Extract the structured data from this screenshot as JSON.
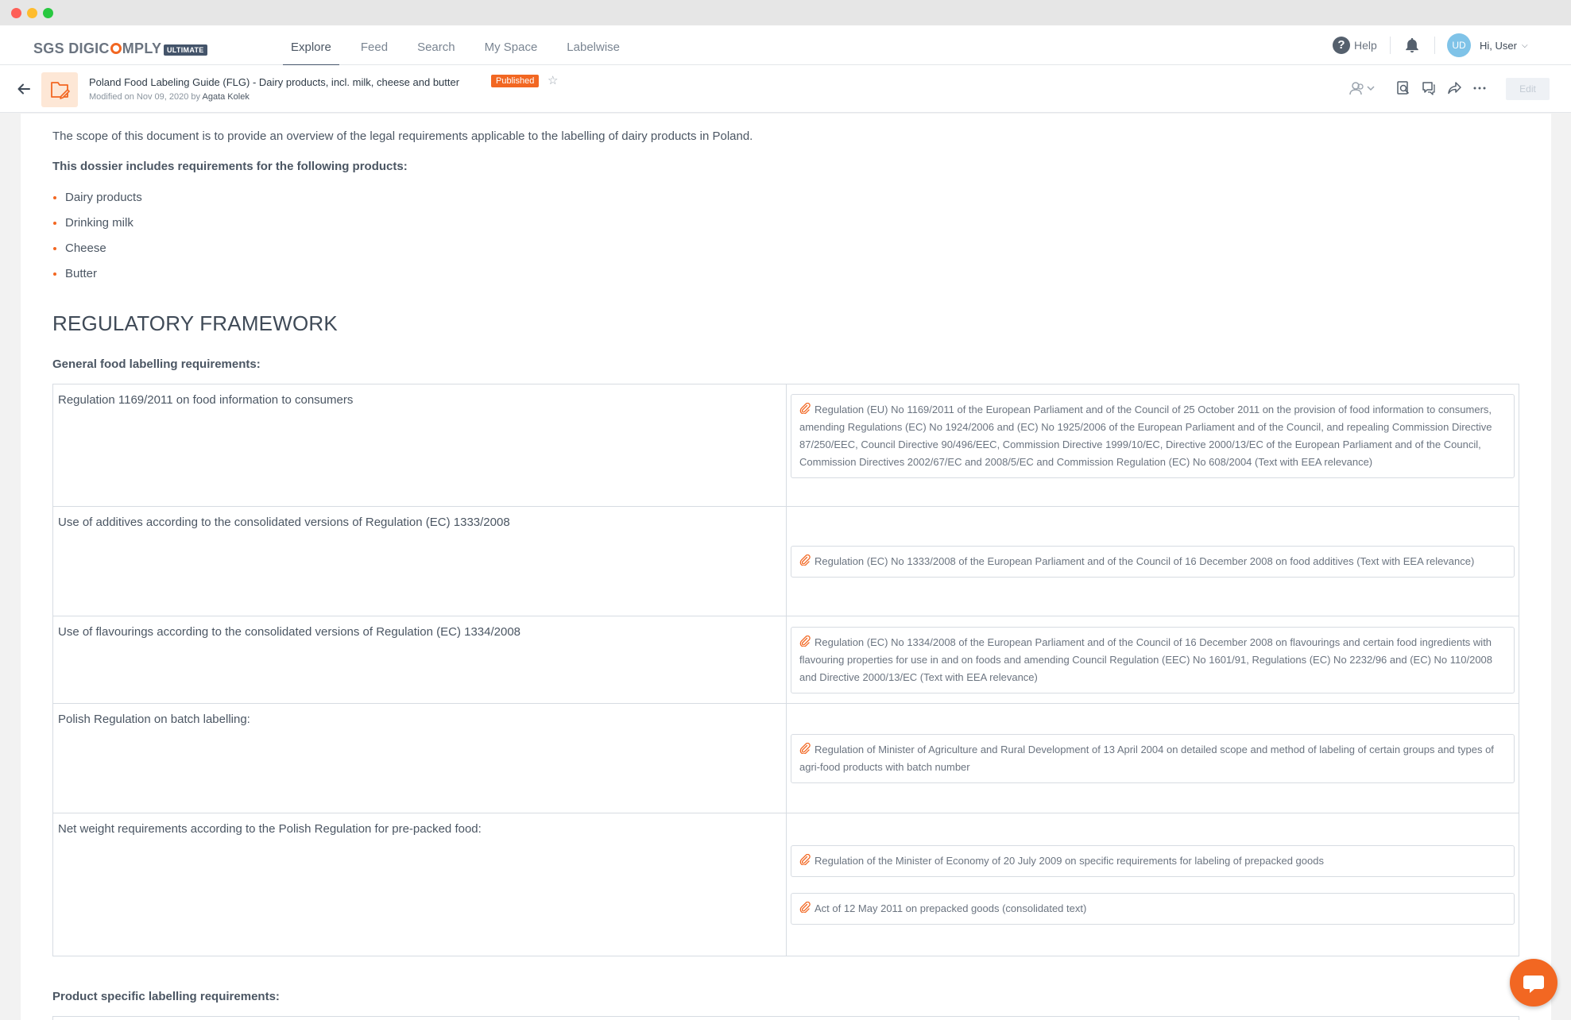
{
  "app": {
    "logo_text": "SGS DIGIC",
    "logo_text_end": "MPLY",
    "tier_badge": "ULTIMATE",
    "nav": [
      {
        "label": "Explore"
      },
      {
        "label": "Feed"
      },
      {
        "label": "Search"
      },
      {
        "label": "My Space"
      },
      {
        "label": "Labelwise"
      }
    ],
    "help_label": "Help",
    "user_initials": "UD",
    "user_greeting": "Hi, User"
  },
  "document": {
    "title": "Poland Food Labeling Guide (FLG) - Dairy products, incl. milk, cheese and butter",
    "status": "Published",
    "modified": "Modified on Nov 09, 2020 by",
    "author": "Agata Kolek",
    "edit_label": "Edit"
  },
  "body": {
    "intro": "The scope of this document is to provide an overview of the legal requirements applicable to the labelling of dairy products in Poland.",
    "products_heading": "This dossier includes requirements for the following products:",
    "products": [
      "Dairy products",
      "Drinking milk",
      "Cheese",
      "Butter"
    ],
    "section_title": "REGULATORY FRAMEWORK",
    "general_heading": "General food labelling requirements:",
    "rows": [
      {
        "requirement": "Regulation 1169/2011 on food information to consumers",
        "refs": [
          "Regulation (EU) No 1169/2011 of the European Parliament and of the Council of 25 October 2011 on the provision of food information to consumers, amending Regulations (EC) No 1924/2006 and (EC) No 1925/2006 of the European Parliament and of the Council, and repealing Commission Directive 87/250/EEC, Council Directive 90/496/EEC, Commission Directive 1999/10/EC, Directive 2000/13/EC of the European Parliament and of the Council, Commission Directives 2002/67/EC and 2008/5/EC and Commission Regulation (EC) No 608/2004 (Text with EEA relevance)"
        ]
      },
      {
        "requirement": "Use of additives according to the consolidated versions of Regulation (EC) 1333/2008",
        "refs": [
          "Regulation (EC) No 1333/2008 of the European Parliament and of the Council of 16 December 2008 on food additives (Text with EEA relevance)"
        ]
      },
      {
        "requirement": "Use of flavourings according to the consolidated versions of Regulation (EC) 1334/2008",
        "refs": [
          "Regulation (EC) No 1334/2008 of the European Parliament and of the Council of 16 December 2008 on flavourings and certain food ingredients with flavouring properties for use in and on foods and amending Council Regulation (EEC) No 1601/91, Regulations (EC) No 2232/96 and (EC) No 110/2008 and Directive 2000/13/EC (Text with EEA relevance)"
        ]
      },
      {
        "requirement": "Polish Regulation on batch labelling:",
        "refs": [
          "Regulation of Minister of Agriculture and Rural Development of 13 April 2004 on detailed scope and method of labeling of certain groups and types of agri-food products with batch number"
        ]
      },
      {
        "requirement": "Net weight requirements according to the Polish Regulation for pre-packed food:",
        "refs": [
          "Regulation of the Minister of Economy of 20 July 2009 on specific requirements for labeling of prepacked goods",
          "Act of 12 May 2011 on prepacked goods (consolidated text)"
        ]
      }
    ],
    "product_specific_heading": "Product specific labelling requirements:"
  },
  "colors": {
    "accent": "#f26722",
    "nav_underline": "#44546a",
    "avatar": "#7fc3e8"
  },
  "icons": [
    "help-icon",
    "bell-icon",
    "back-arrow-icon",
    "document-icon",
    "star-icon",
    "collaborators-icon",
    "preview-icon",
    "comments-icon",
    "share-icon",
    "more-icon",
    "paperclip-icon",
    "chat-icon"
  ]
}
